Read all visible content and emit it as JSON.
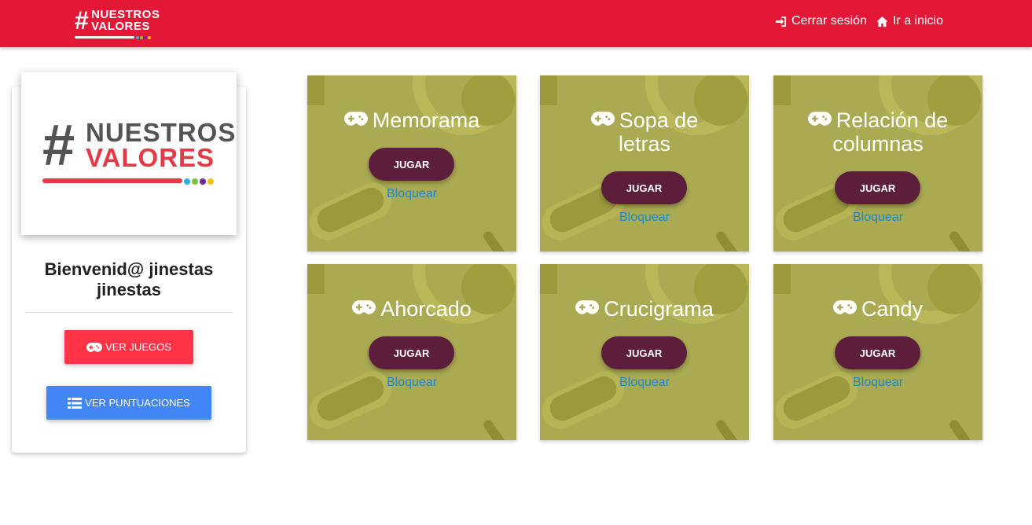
{
  "navbar": {
    "logo_hash": "#",
    "logo_line1": "NUESTROS",
    "logo_line2": "VALORES",
    "logout_label": "Cerrar sesión",
    "home_label": "Ir a inicio"
  },
  "sidebar": {
    "logo_hash": "#",
    "logo_line1": "NUESTROS",
    "logo_line2": "VALORES",
    "welcome_text": "Bienvenid@ jinestas jinestas",
    "games_button": "VER JUEGOS",
    "scores_button": "VER PUNTUACIONES"
  },
  "games": [
    {
      "title": "Memorama",
      "play": "JUGAR",
      "block": "Bloquear"
    },
    {
      "title": "Sopa de letras",
      "play": "JUGAR",
      "block": "Bloquear"
    },
    {
      "title": "Relación de columnas",
      "play": "JUGAR",
      "block": "Bloquear"
    },
    {
      "title": "Ahorcado",
      "play": "JUGAR",
      "block": "Bloquear"
    },
    {
      "title": "Crucigrama",
      "play": "JUGAR",
      "block": "Bloquear"
    },
    {
      "title": "Candy",
      "play": "JUGAR",
      "block": "Bloquear"
    }
  ],
  "colors": {
    "navbar": "#e31837",
    "card": "#aaaa52",
    "play_button": "#5c1e3a",
    "games_button": "#ff3547",
    "scores_button": "#4285f4",
    "link": "#1e88c8"
  },
  "icons": {
    "logout": "sign-in-icon",
    "home": "home-icon",
    "game": "gamepad-icon",
    "list": "list-icon"
  }
}
